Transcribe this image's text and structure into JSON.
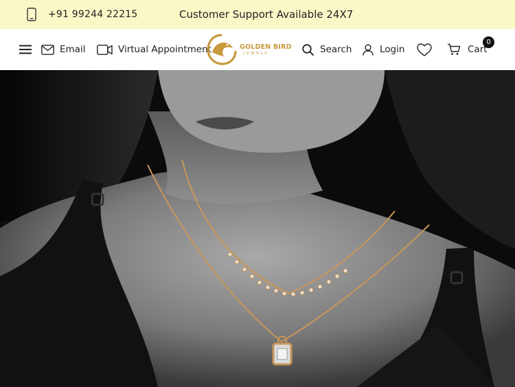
{
  "topbar": {
    "phone": "+91 99244 22215",
    "support": "Customer Support Available 24X7"
  },
  "header": {
    "email_label": "Email",
    "virtual_label": "Virtual Appointment",
    "logo_line1": "GOLDEN BIRD",
    "logo_line2": "JEWELS",
    "search_label": "Search",
    "login_label": "Login",
    "cart_label": "Cart",
    "cart_count": "0"
  },
  "icons": {
    "phone": "phone-icon",
    "menu": "menu-icon",
    "email": "envelope-icon",
    "virtual": "video-camera-icon",
    "search": "search-icon",
    "login": "user-icon",
    "wishlist": "heart-icon",
    "cart": "cart-icon"
  },
  "colors": {
    "topbar_bg": "#fbf8c8",
    "brand_gold": "#c89a3e",
    "badge_bg": "#111111"
  }
}
